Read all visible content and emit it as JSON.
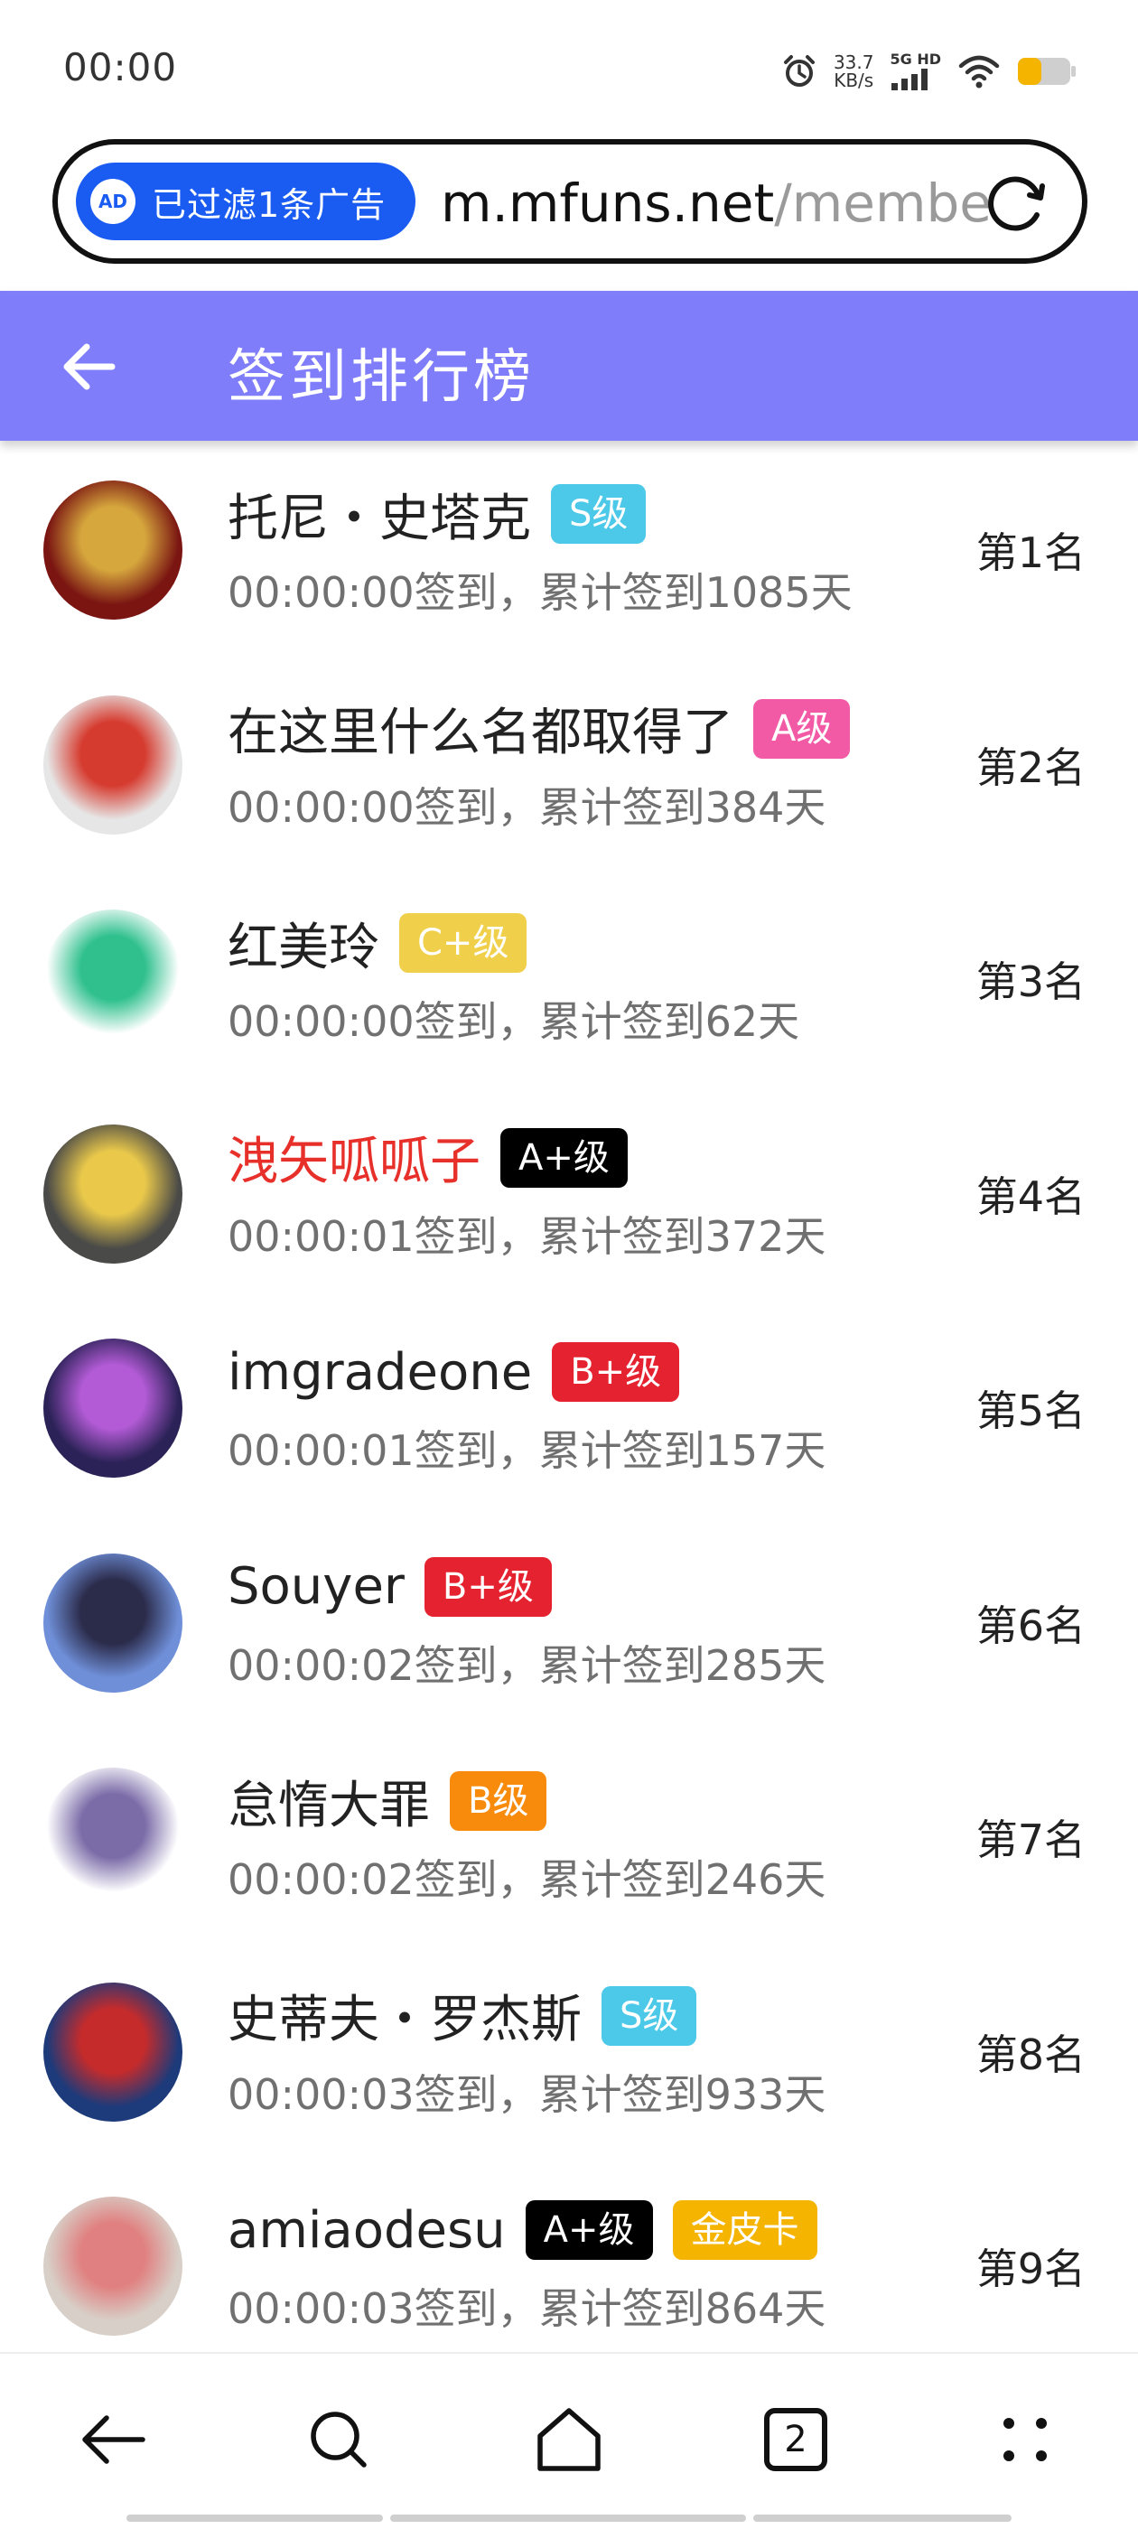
{
  "status_bar": {
    "time": "00:00",
    "speed_value": "33.7",
    "speed_unit": "KB/s",
    "network": "5G HD"
  },
  "url_bar": {
    "ad_badge_icon_text": "AD",
    "ad_filter_text": "已过滤1条广告",
    "url_host": "m.mfuns.net",
    "url_path": "/membe"
  },
  "header": {
    "title": "签到排行榜"
  },
  "list": {
    "rows": [
      {
        "name": "托尼・史塔克",
        "badges": [
          {
            "text": "S级",
            "color": "#4cc8e8"
          }
        ],
        "sub": "00:00:00签到，累计签到1085天",
        "rank": "第1名",
        "name_color": "#222222",
        "avatar_colors": [
          "#7a1512",
          "#d6a73d"
        ]
      },
      {
        "name": "在这里什么名都取得了",
        "badges": [
          {
            "text": "A级",
            "color": "#f25aa6"
          }
        ],
        "sub": "00:00:00签到，累计签到384天",
        "rank": "第2名",
        "name_color": "#222222",
        "avatar_colors": [
          "#e6e6e6",
          "#d63b2f"
        ]
      },
      {
        "name": "红美玲",
        "badges": [
          {
            "text": "C+级",
            "color": "#f0d04a"
          }
        ],
        "sub": "00:00:00签到，累计签到62天",
        "rank": "第3名",
        "name_color": "#222222",
        "avatar_colors": [
          "#ffffff",
          "#2fc08e"
        ]
      },
      {
        "name": "洩矢呱呱子",
        "badges": [
          {
            "text": "A+级",
            "color": "#000000"
          }
        ],
        "sub": "00:00:01签到，累计签到372天",
        "rank": "第4名",
        "name_color": "#e8302a",
        "avatar_colors": [
          "#4a4a48",
          "#e9c84a"
        ]
      },
      {
        "name": "imgradeone",
        "badges": [
          {
            "text": "B+级",
            "color": "#e5222f"
          }
        ],
        "sub": "00:00:01签到，累计签到157天",
        "rank": "第5名",
        "name_color": "#222222",
        "avatar_colors": [
          "#2b2257",
          "#b35bd6"
        ]
      },
      {
        "name": "Souyer",
        "badges": [
          {
            "text": "B+级",
            "color": "#e5222f"
          }
        ],
        "sub": "00:00:02签到，累计签到285天",
        "rank": "第6名",
        "name_color": "#222222",
        "avatar_colors": [
          "#6f8fd8",
          "#2b2b4a"
        ]
      },
      {
        "name": "怠惰大罪",
        "badges": [
          {
            "text": "B级",
            "color": "#f88b0c"
          }
        ],
        "sub": "00:00:02签到，累计签到246天",
        "rank": "第7名",
        "name_color": "#222222",
        "avatar_colors": [
          "#ffffff",
          "#7b6ca8"
        ]
      },
      {
        "name": "史蒂夫・罗杰斯",
        "badges": [
          {
            "text": "S级",
            "color": "#4cc8e8"
          }
        ],
        "sub": "00:00:03签到，累计签到933天",
        "rank": "第8名",
        "name_color": "#222222",
        "avatar_colors": [
          "#1d3a7a",
          "#c62b2b"
        ]
      },
      {
        "name": "amiaodesu",
        "badges": [
          {
            "text": "A+级",
            "color": "#000000"
          },
          {
            "text": "金皮卡",
            "color": "#f5b400"
          }
        ],
        "sub": "00:00:03签到，累计签到864天",
        "rank": "第9名",
        "name_color": "#222222",
        "avatar_colors": [
          "#d8d0c8",
          "#e08080"
        ]
      }
    ]
  },
  "bottom_nav": {
    "tab_count": "2",
    "icons": [
      "back-icon",
      "search-icon",
      "home-icon",
      "tabs-icon",
      "menu-icon"
    ]
  }
}
